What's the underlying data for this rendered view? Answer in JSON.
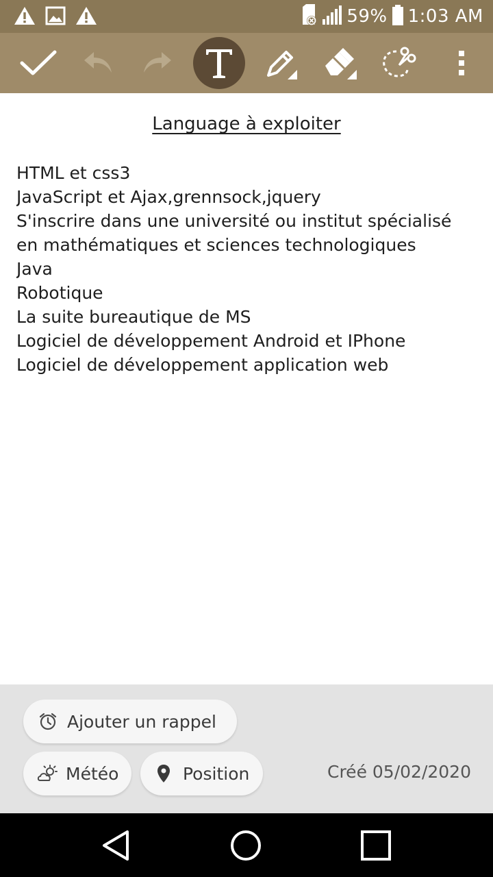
{
  "status_bar": {
    "battery_text": "59%",
    "time": "1:03 AM",
    "icons_left": [
      "warning-icon",
      "image-icon",
      "warning-icon"
    ],
    "icons_right": [
      "sd-card-error-icon",
      "signal-icon",
      "battery-icon"
    ]
  },
  "toolbar": {
    "tools": [
      "check-icon",
      "undo-icon",
      "redo-icon",
      "text-tool-icon",
      "pen-icon",
      "eraser-icon",
      "lasso-scissors-icon",
      "more-vert-icon"
    ],
    "active_tool": "text-tool-icon",
    "colors": {
      "status_bar": "#8a7856",
      "toolbar": "#9f8b69",
      "active_tool_bg": "#5c4a35"
    }
  },
  "note": {
    "title": "Language à exploiter",
    "lines": [
      "HTML et css3",
      "JavaScript et Ajax,grennsock,jquery",
      "S'inscrire dans une université ou institut spécialisé",
      "en mathématiques et sciences technologiques",
      "Java",
      "Robotique",
      "La suite bureautique de MS",
      "Logiciel de développement Android et IPhone",
      "Logiciel de développement application web"
    ]
  },
  "meta": {
    "reminder_label": "Ajouter un rappel",
    "weather_label": "Météo",
    "position_label": "Position",
    "created_text": "Créé 05/02/2020"
  },
  "nav": {
    "buttons": [
      "back-icon",
      "home-icon",
      "recents-icon"
    ]
  }
}
